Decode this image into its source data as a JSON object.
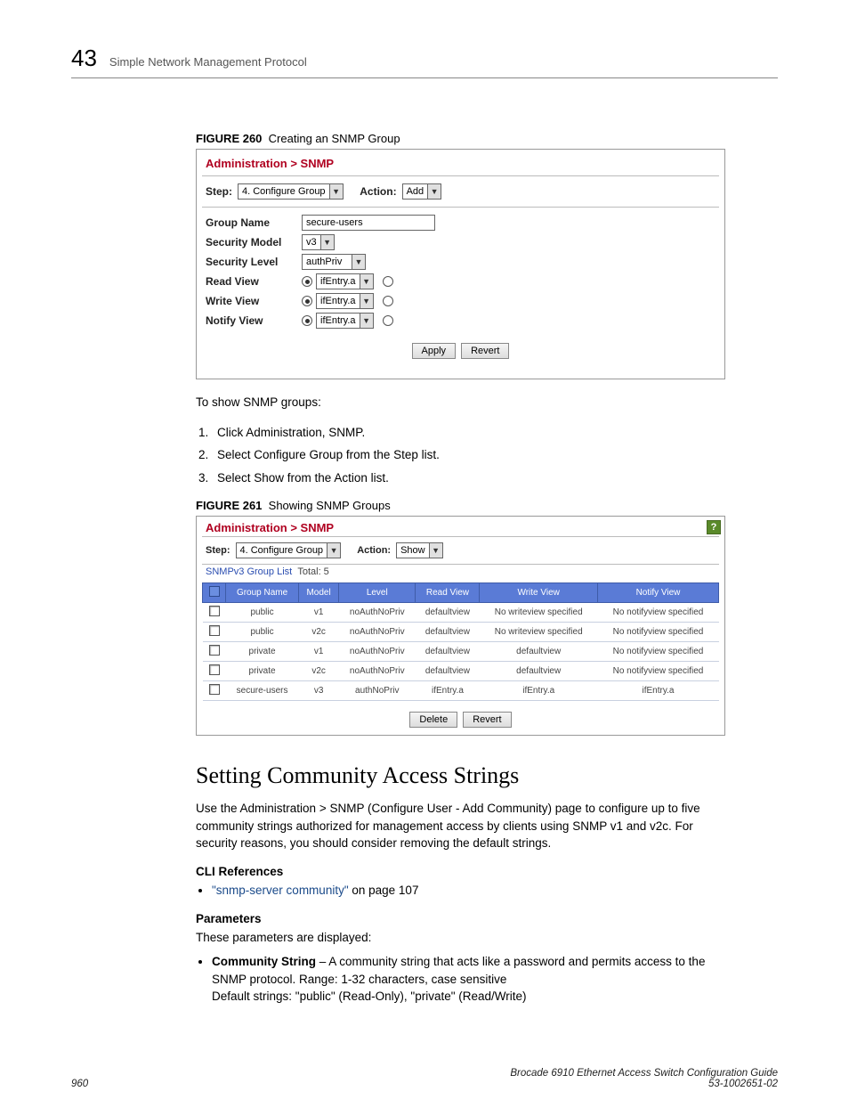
{
  "header": {
    "page_number": "43",
    "title": "Simple Network Management Protocol"
  },
  "figure260": {
    "label": "FIGURE 260",
    "caption": "Creating an SNMP Group"
  },
  "panel1": {
    "breadcrumb": "Administration > SNMP",
    "step_label": "Step:",
    "step_value": "4. Configure Group",
    "action_label": "Action:",
    "action_value": "Add",
    "rows": {
      "group_name_label": "Group Name",
      "group_name_value": "secure-users",
      "security_model_label": "Security Model",
      "security_model_value": "v3",
      "security_level_label": "Security Level",
      "security_level_value": "authPriv",
      "read_view_label": "Read View",
      "read_view_value": "ifEntry.a",
      "write_view_label": "Write View",
      "write_view_value": "ifEntry.a",
      "notify_view_label": "Notify View",
      "notify_view_value": "ifEntry.a"
    },
    "apply_btn": "Apply",
    "revert_btn": "Revert"
  },
  "intro2": "To show SNMP groups:",
  "steps2": [
    "Click Administration, SNMP.",
    "Select Configure Group from the Step list.",
    "Select Show from the Action list."
  ],
  "figure261": {
    "label": "FIGURE 261",
    "caption": "Showing SNMP Groups"
  },
  "panel2": {
    "breadcrumb": "Administration > SNMP",
    "help": "?",
    "step_label": "Step:",
    "step_value": "4. Configure Group",
    "action_label": "Action:",
    "action_value": "Show",
    "list_title": "SNMPv3 Group List",
    "total_label": "Total: 5",
    "columns": [
      "",
      "Group Name",
      "Model",
      "Level",
      "Read View",
      "Write View",
      "Notify View"
    ],
    "rows": [
      {
        "name": "public",
        "model": "v1",
        "level": "noAuthNoPriv",
        "read": "defaultview",
        "write": "No writeview specified",
        "notify": "No notifyview specified"
      },
      {
        "name": "public",
        "model": "v2c",
        "level": "noAuthNoPriv",
        "read": "defaultview",
        "write": "No writeview specified",
        "notify": "No notifyview specified"
      },
      {
        "name": "private",
        "model": "v1",
        "level": "noAuthNoPriv",
        "read": "defaultview",
        "write": "defaultview",
        "notify": "No notifyview specified"
      },
      {
        "name": "private",
        "model": "v2c",
        "level": "noAuthNoPriv",
        "read": "defaultview",
        "write": "defaultview",
        "notify": "No notifyview specified"
      },
      {
        "name": "secure-users",
        "model": "v3",
        "level": "authNoPriv",
        "read": "ifEntry.a",
        "write": "ifEntry.a",
        "notify": "ifEntry.a"
      }
    ],
    "delete_btn": "Delete",
    "revert_btn": "Revert"
  },
  "section_heading": "Setting Community Access Strings",
  "section_intro": "Use the Administration > SNMP (Configure User - Add Community) page to configure up to five community strings authorized for management access by clients using SNMP v1 and v2c. For security reasons, you should consider removing the default strings.",
  "cli_heading": "CLI References",
  "cli_link": "\"snmp-server community\"",
  "cli_tail": " on page 107",
  "params_heading": "Parameters",
  "params_intro": "These parameters are displayed:",
  "param_name": "Community String",
  "param_desc": " – A community string that acts like a password and permits access to the SNMP protocol. Range: 1-32 characters, case sensitive",
  "param_default": "Default strings: \"public\" (Read-Only), \"private\" (Read/Write)",
  "footer": {
    "page": "960",
    "doc_title": "Brocade 6910 Ethernet Access Switch Configuration Guide",
    "doc_num": "53-1002651-02"
  }
}
